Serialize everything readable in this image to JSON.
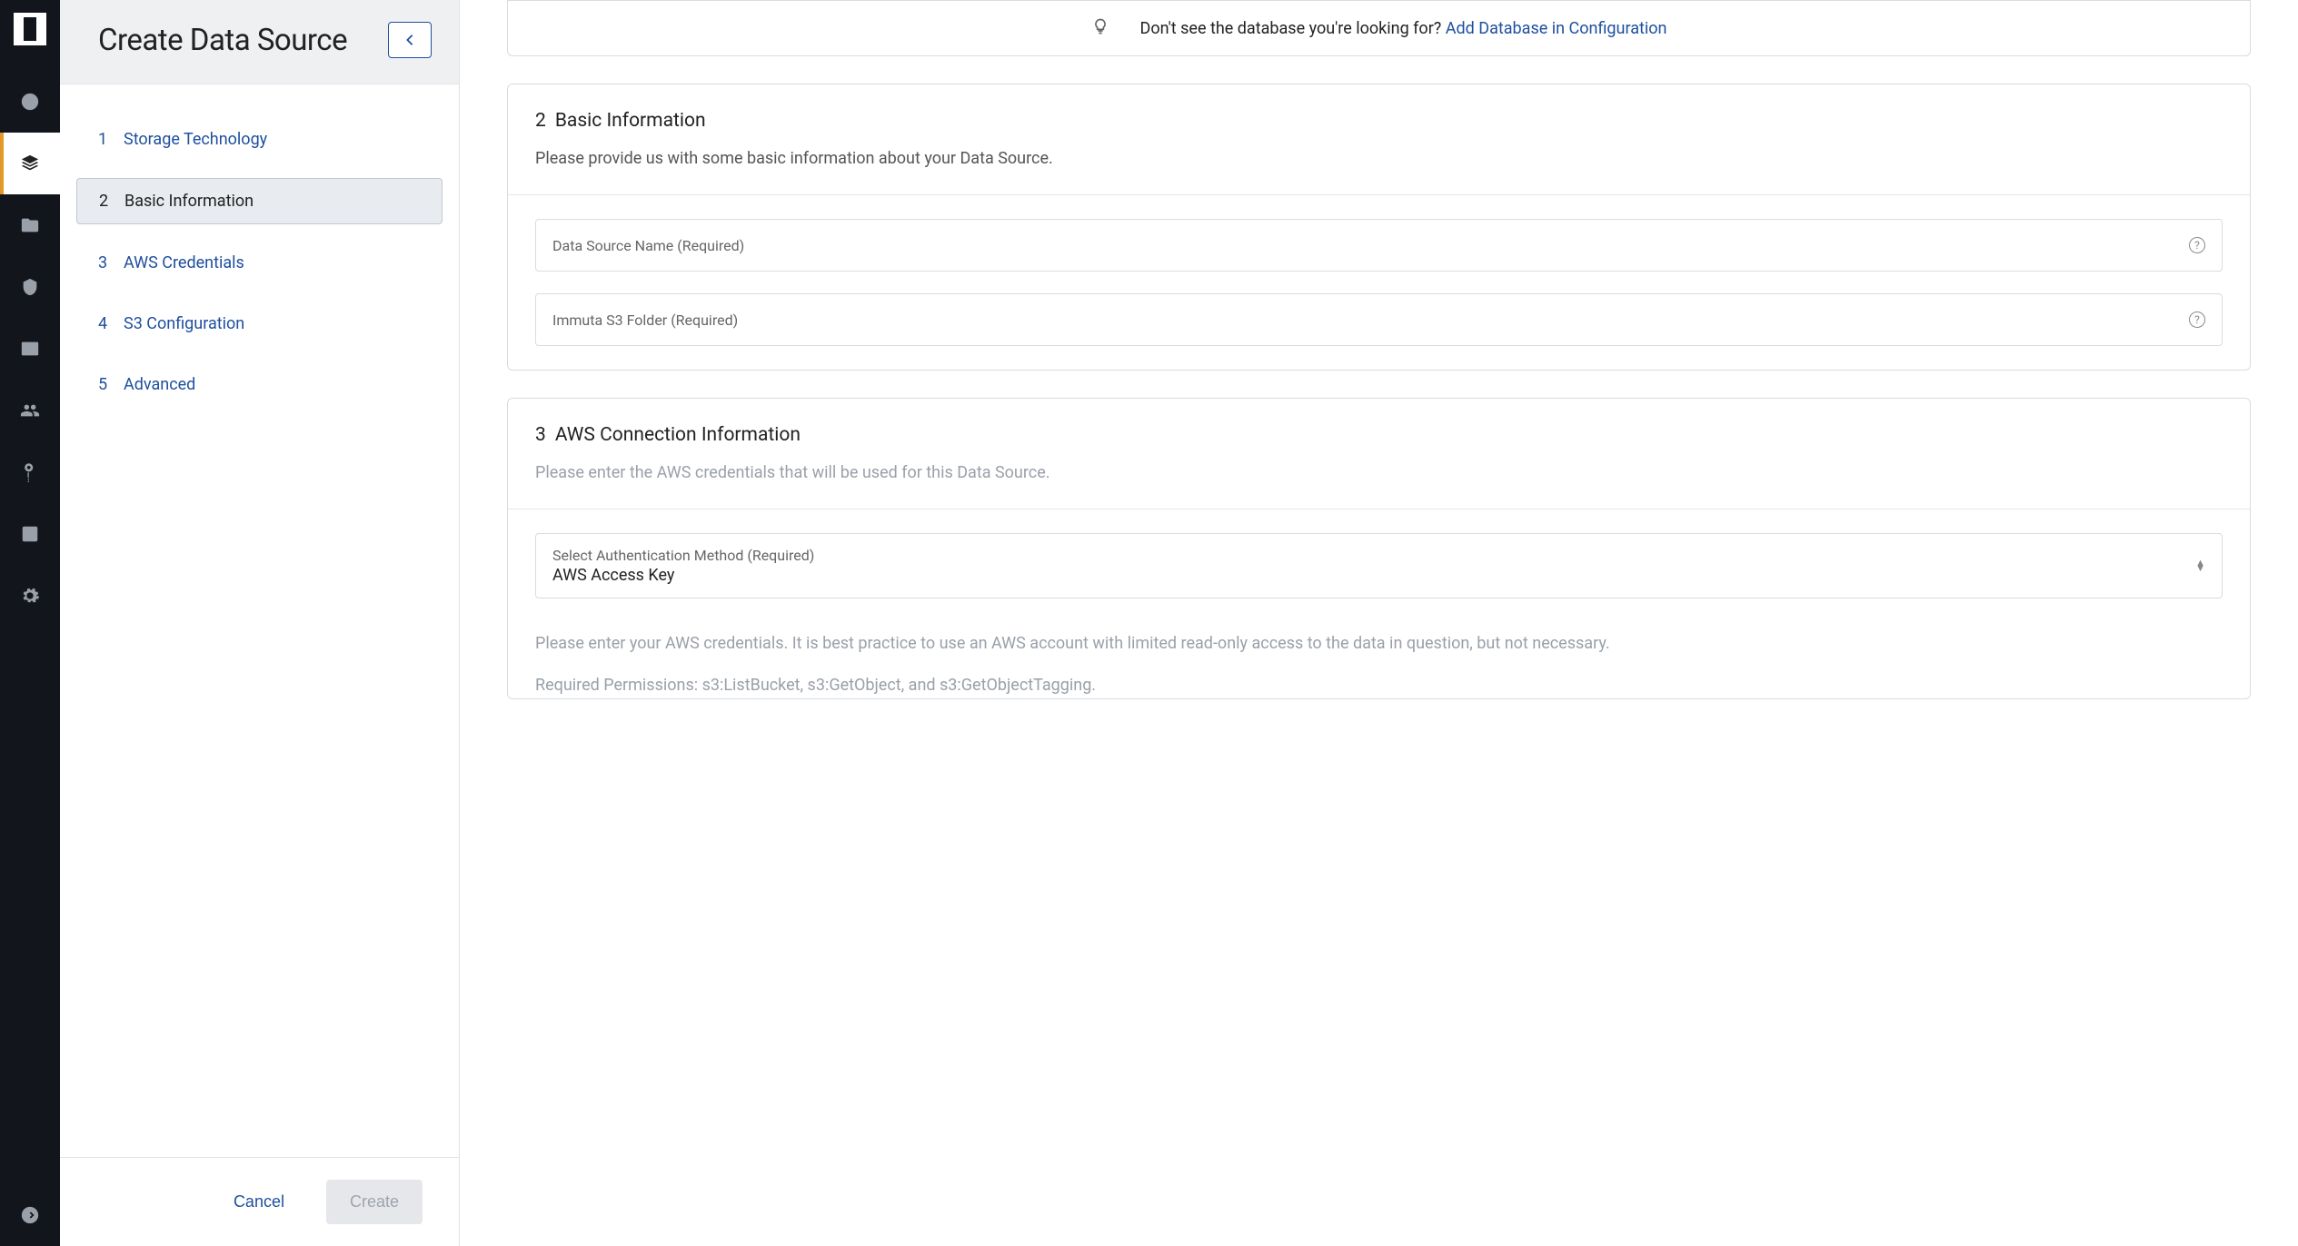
{
  "sidebar": {
    "title": "Create Data Source",
    "steps": [
      {
        "num": "1",
        "label": "Storage Technology"
      },
      {
        "num": "2",
        "label": "Basic Information"
      },
      {
        "num": "3",
        "label": "AWS Credentials"
      },
      {
        "num": "4",
        "label": "S3 Configuration"
      },
      {
        "num": "5",
        "label": "Advanced"
      }
    ],
    "cancel_label": "Cancel",
    "create_label": "Create"
  },
  "tip": {
    "text": "Don't see the database you're looking for? ",
    "link": "Add Database in Configuration"
  },
  "section2": {
    "num": "2",
    "title": "Basic Information",
    "desc": "Please provide us with some basic information about your Data Source.",
    "field1_label": "Data Source Name (Required)",
    "field2_label": "Immuta S3 Folder (Required)"
  },
  "section3": {
    "num": "3",
    "title": "AWS Connection Information",
    "desc": "Please enter the AWS credentials that will be used for this Data Source.",
    "auth_label": "Select Authentication Method (Required)",
    "auth_value": "AWS Access Key",
    "note1": "Please enter your AWS credentials. It is best practice to use an AWS account with limited read-only access to the data in question, but not necessary.",
    "note2": "Required Permissions: s3:ListBucket, s3:GetObject, and s3:GetObjectTagging."
  }
}
